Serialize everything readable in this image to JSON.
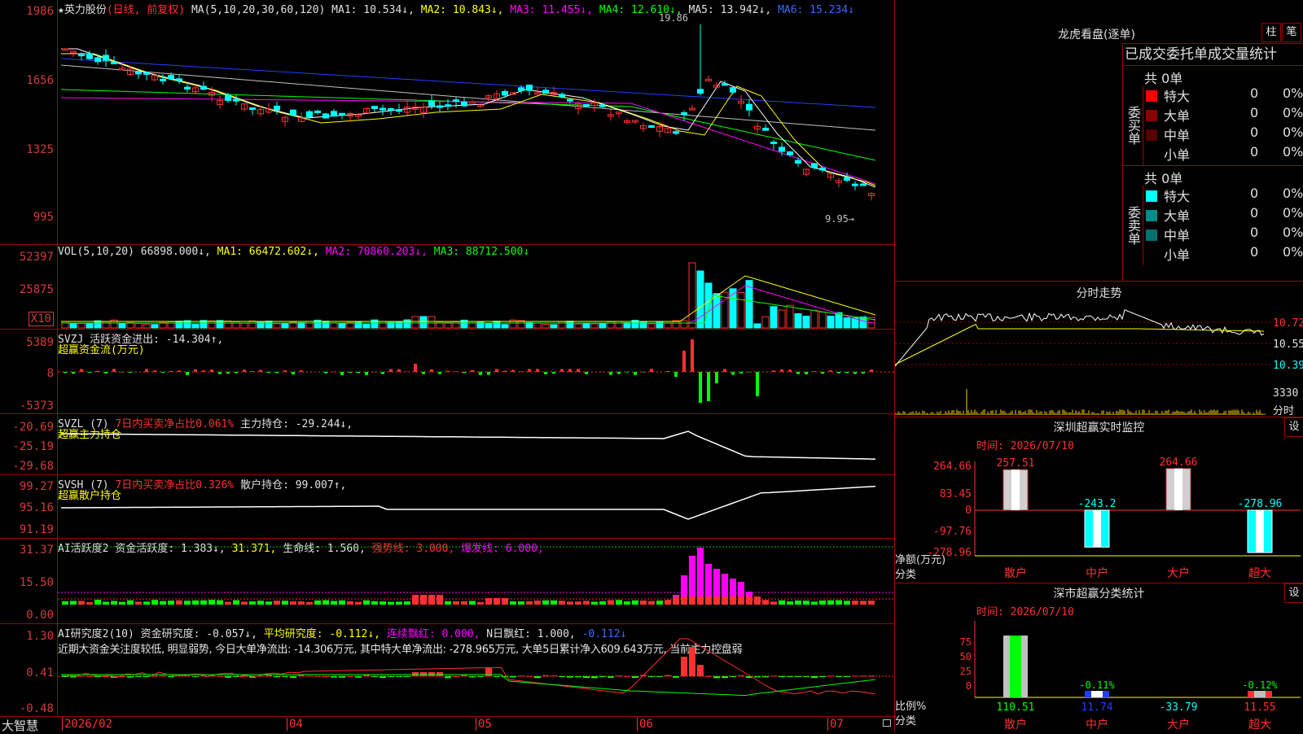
{
  "stock": {
    "name": "★英力股份",
    "mode": "(日线, 前复权)"
  },
  "colors": {
    "up": "#ff3030",
    "down": "#00ffff",
    "border": "#a00000",
    "ma1": "#ffffff",
    "ma2": "#ffff00",
    "ma3": "#ff00ff",
    "ma4": "#00ff00",
    "ma5": "#c0c0c0",
    "ma6": "#2040ff"
  },
  "price_panel": {
    "ma_header": "MA(5,10,20,30,60,120)",
    "ma1": "MA1: 10.534↓,",
    "ma2": "MA2: 10.843↓,",
    "ma3": "MA3: 11.455↓,",
    "ma4": "MA4: 12.610↓,",
    "ma5": "MA5: 13.942↓,",
    "ma6": "MA6: 15.234↓",
    "y_labels": [
      "1986",
      "1656",
      "1325",
      "995"
    ],
    "high_label": "19.86",
    "low_label": "9.95→"
  },
  "vol_panel": {
    "header": "VOL(5,10,20)",
    "value": "66898.000↓,",
    "ma1": "MA1: 66472.602↓,",
    "ma2": "MA2: 70860.203↓,",
    "ma3": "MA3: 88712.500↓",
    "y_labels": [
      "52397",
      "25875"
    ],
    "unit": "X10"
  },
  "svzj_panel": {
    "header": "SVZJ",
    "value": "活跃资金进出: -14.304↑,",
    "subtitle": "超赢资金流(万元)",
    "y_labels": [
      "5389",
      "8",
      "-5373"
    ]
  },
  "svzl_panel": {
    "header": "SVZL (7)",
    "net": "7日内买卖净占比0.061%",
    "value": "主力持仓: -29.244↓,",
    "subtitle": "超赢主力持仓",
    "y_labels": [
      "-20.69",
      "-25.19",
      "-29.68"
    ]
  },
  "svsh_panel": {
    "header": "SVSH (7)",
    "net": "7日内买卖净占比0.326%",
    "value": "散户持仓: 99.007↑,",
    "subtitle": "超赢散户持仓",
    "y_labels": [
      "99.27",
      "95.16",
      "91.19"
    ]
  },
  "ai_act_panel": {
    "header": "AI活跃度2",
    "value": "资金活跃度: 1.383↓,",
    "v2": "31.371,",
    "life": "生命线: 1.560,",
    "strong": "强势线: 3.000,",
    "burst": "爆发线: 6.000,",
    "y_labels": [
      "31.37",
      "15.50",
      "0.00"
    ]
  },
  "ai_res_panel": {
    "header": "AI研究度2(10)",
    "value": "资金研究度: -0.057↓,",
    "avg": "平均研究度: -0.112↓,",
    "red1": "连续飘红: 0.000,",
    "red2": "N日飘红: 1.000,",
    "last": "-0.112↓",
    "comment": "近期大资金关注度较低, 明显弱势, 今日大单净流出: -14.306万元, 其中特大单净流出: -278.965万元, 大单5日累计净入609.643万元, 当前主力控盘弱",
    "y_labels": [
      "1.30",
      "0.41",
      "-0.48"
    ]
  },
  "date_axis": {
    "brand": "大智慧",
    "labels": [
      "2026/02",
      "04",
      "05",
      "06",
      "07"
    ]
  },
  "lhb": {
    "title": "龙虎看盘(逐单)",
    "btn1": "柱",
    "btn2": "笔",
    "head": "已成交委托单成交量统计",
    "buy_label": "委买单",
    "buy_total": "共 0单",
    "sell_label": "委卖单",
    "sell_total": "共 0单",
    "buy_rows": [
      {
        "name": "特大",
        "val": "0",
        "pct": "0%",
        "color": "#ff0000"
      },
      {
        "name": "大单",
        "val": "0",
        "pct": "0%",
        "color": "#8b0000"
      },
      {
        "name": "中单",
        "val": "0",
        "pct": "0%",
        "color": "#5a0000"
      },
      {
        "name": "小单",
        "val": "0",
        "pct": "0%",
        "color": "#000000"
      }
    ],
    "sell_rows": [
      {
        "name": "特大",
        "val": "0",
        "pct": "0%",
        "color": "#00ffff"
      },
      {
        "name": "大单",
        "val": "0",
        "pct": "0%",
        "color": "#008b8b"
      },
      {
        "name": "中单",
        "val": "0",
        "pct": "0%",
        "color": "#007070"
      },
      {
        "name": "小单",
        "val": "0",
        "pct": "0%",
        "color": "#000000"
      }
    ]
  },
  "intraday": {
    "title": "分时走势",
    "labels": [
      "10.72",
      "10.55",
      "10.39"
    ],
    "vol_label": "3330",
    "unit": "分时"
  },
  "sz_monitor": {
    "title": "深圳超赢实时监控",
    "set": "设",
    "time": "时间: 2026/07/10",
    "y_labels": [
      "264.66",
      "83.45",
      "0",
      "-97.76",
      "-278.96"
    ],
    "y_unit": "净额(万元)",
    "x_unit": "分类",
    "categories": [
      "散户",
      "中户",
      "大户",
      "超大"
    ],
    "values": [
      257.51,
      -243.2,
      264.66,
      -278.96
    ],
    "value_labels": [
      "257.51",
      "-243.2",
      "264.66",
      "-278.96"
    ]
  },
  "sz_class": {
    "title": "深市超赢分类统计",
    "set": "设",
    "time": "时间: 2026/07/10",
    "y_labels": [
      "75",
      "50",
      "25",
      "0"
    ],
    "y_unit": "比例%",
    "x_unit": "分类",
    "categories": [
      "散户",
      "中户",
      "大户",
      "超大"
    ],
    "bar_labels": [
      "",
      "-0.11%",
      "",
      "-0.12%"
    ],
    "bottom_values": [
      "110.51",
      "11.74",
      "-33.79",
      "11.55"
    ]
  }
}
